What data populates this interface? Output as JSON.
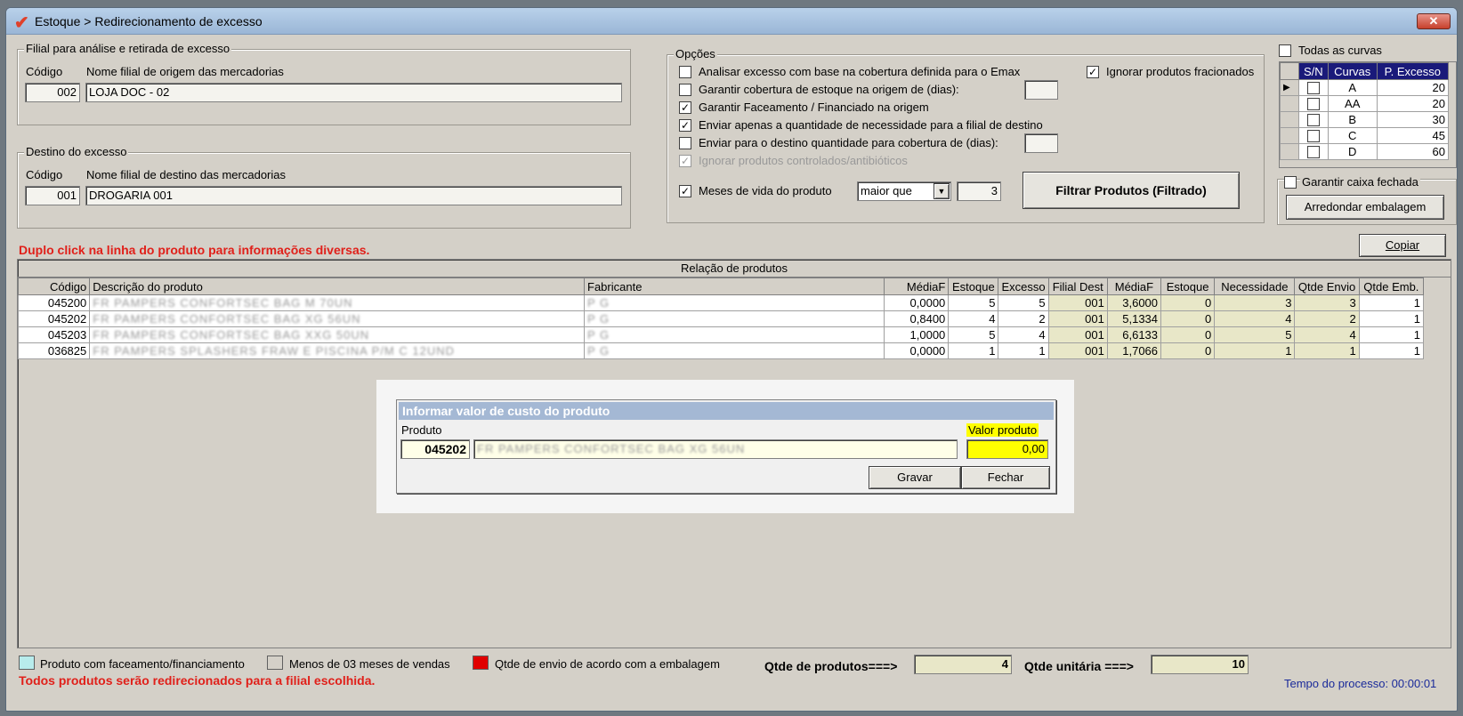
{
  "window": {
    "title": "Estoque > Redirecionamento de excesso",
    "close": "✕"
  },
  "origem": {
    "group_label": "Filial para análise e retirada de excesso",
    "codigo_label": "Código",
    "nome_label": "Nome filial de origem das mercadorias",
    "codigo": "002",
    "nome": "LOJA DOC - 02"
  },
  "destino": {
    "group_label": "Destino do excesso",
    "codigo_label": "Código",
    "nome_label": "Nome filial de destino das mercadorias",
    "codigo": "001",
    "nome": "DROGARIA 001"
  },
  "opcoes": {
    "group_label": "Opções",
    "items": [
      {
        "label": "Analisar excesso com base na cobertura definida para o Emax",
        "checked": "",
        "enabled": true
      },
      {
        "label": "Garantir cobertura de estoque na origem de (dias):",
        "checked": "",
        "enabled": true
      },
      {
        "label": "Garantir Faceamento / Financiado na origem",
        "checked": "✓",
        "enabled": true
      },
      {
        "label": "Enviar apenas a quantidade de necessidade para a filial de destino",
        "checked": "✓",
        "enabled": true
      },
      {
        "label": "Enviar para o destino quantidade para cobertura de (dias):",
        "checked": "",
        "enabled": true
      },
      {
        "label": "Ignorar produtos controlados/antibióticos",
        "checked": "✓",
        "enabled": false
      }
    ],
    "ignorar_fracionados": {
      "label": "Ignorar produtos fracionados",
      "checked": "✓"
    },
    "meses_vida": {
      "label": "Meses de vida do produto",
      "checked": "✓",
      "operator": "maior que",
      "value": "3"
    },
    "filtrar_button": "Filtrar Produtos (Filtrado)"
  },
  "curvas": {
    "todas_label": "Todas as curvas",
    "headers": [
      "S/N",
      "Curvas",
      "P. Excesso"
    ],
    "rows": [
      {
        "curva": "A",
        "excesso": "20"
      },
      {
        "curva": "AA",
        "excesso": "20"
      },
      {
        "curva": "B",
        "excesso": "30"
      },
      {
        "curva": "C",
        "excesso": "45"
      },
      {
        "curva": "D",
        "excesso": "60"
      }
    ]
  },
  "caixa": {
    "label": "Garantir caixa fechada",
    "button": "Arredondar embalagem"
  },
  "hint": "Duplo click na linha do produto para informações diversas.",
  "copiar_button": "Copiar",
  "produtos": {
    "caption": "Relação de produtos",
    "headers": [
      "Código",
      "Descrição do produto",
      "Fabricante",
      "MédiaF",
      "Estoque",
      "Excesso",
      "Filial Dest",
      "MédiaF",
      "Estoque",
      "Necessidade",
      "Qtde Envio",
      "Qtde Emb."
    ],
    "rows": [
      {
        "codigo": "045200",
        "descricao": "FR PAMPERS CONFORTSEC BAG M 70UN",
        "fabricante": "P G",
        "mediaf": "0,0000",
        "estoque": "5",
        "excesso": "5",
        "filial": "001",
        "mediaf_d": "3,6000",
        "estoque_d": "0",
        "necessidade": "3",
        "envio": "3",
        "emb": "1"
      },
      {
        "codigo": "045202",
        "descricao": "FR PAMPERS CONFORTSEC BAG XG 56UN",
        "fabricante": "P G",
        "mediaf": "0,8400",
        "estoque": "4",
        "excesso": "2",
        "filial": "001",
        "mediaf_d": "5,1334",
        "estoque_d": "0",
        "necessidade": "4",
        "envio": "2",
        "emb": "1"
      },
      {
        "codigo": "045203",
        "descricao": "FR PAMPERS CONFORTSEC BAG XXG 50UN",
        "fabricante": "P G",
        "mediaf": "1,0000",
        "estoque": "5",
        "excesso": "4",
        "filial": "001",
        "mediaf_d": "6,6133",
        "estoque_d": "0",
        "necessidade": "5",
        "envio": "4",
        "emb": "1"
      },
      {
        "codigo": "036825",
        "descricao": "FR PAMPERS SPLASHERS FRAW E PISCINA P/M C 12UND",
        "fabricante": "P G",
        "mediaf": "0,0000",
        "estoque": "1",
        "excesso": "1",
        "filial": "001",
        "mediaf_d": "1,7066",
        "estoque_d": "0",
        "necessidade": "1",
        "envio": "1",
        "emb": "1"
      }
    ]
  },
  "dialog": {
    "title": "Informar valor de custo do produto",
    "produto_label": "Produto",
    "codigo": "045202",
    "descricao": "FR PAMPERS CONFORTSEC BAG XG 56UN",
    "valor_label": "Valor produto",
    "valor": "0,00",
    "gravar": "Gravar",
    "fechar": "Fechar"
  },
  "legend": [
    {
      "label": "Produto com faceamento/financiamento",
      "color": "#b8ecec"
    },
    {
      "label": "Menos de 03 meses de vendas",
      "color": "#d4d0c8"
    },
    {
      "label": "Qtde de envio de acordo com a embalagem",
      "color": "#e00000"
    }
  ],
  "totais": {
    "qtde_produtos_label": "Qtde de produtos===>",
    "qtde_produtos": "4",
    "qtde_unitaria_label": "Qtde unitária ===>",
    "qtde_unitaria": "10"
  },
  "footer_warning": "Todos produtos serão redirecionados para a filial escolhida.",
  "tempo": "Tempo do processo: 00:00:01"
}
